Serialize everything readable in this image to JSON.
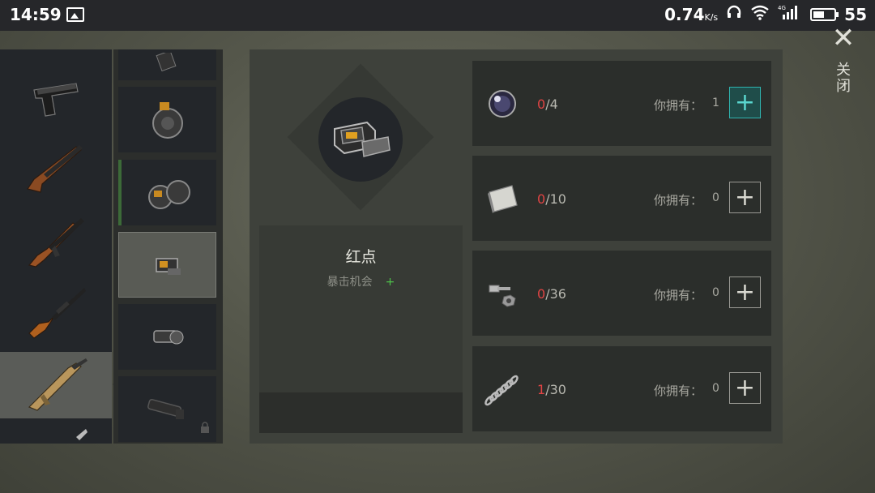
{
  "status_bar": {
    "time": "14:59",
    "speed": "0.74",
    "speed_unit": "K/s",
    "battery": "55",
    "battery_level": 0.55,
    "icons": [
      "image-icon",
      "headphones-icon",
      "wifi-icon",
      "signal-4g-icon",
      "battery-icon"
    ]
  },
  "weapons": [
    {
      "name": "pistol-icon"
    },
    {
      "name": "shotgun-icon"
    },
    {
      "name": "ak-rifle-icon"
    },
    {
      "name": "sniper-rifle-icon"
    },
    {
      "name": "scar-rifle-icon",
      "selected": true
    },
    {
      "name": "partial-rifle-icon"
    }
  ],
  "attachments": [
    {
      "name": "magazine-icon"
    },
    {
      "name": "drum-magazine-icon"
    },
    {
      "name": "dual-drum-magazine-icon"
    },
    {
      "name": "red-dot-sight-icon",
      "selected": true
    },
    {
      "name": "scope-2x-icon"
    },
    {
      "name": "scope-long-icon",
      "locked": true
    }
  ],
  "detail": {
    "item_icon": "red-dot-sight-icon",
    "name": "红点",
    "stat_label": "暴击机会",
    "stat_value": "+"
  },
  "materials": [
    {
      "icon": "lens-icon",
      "current": "0",
      "required": "/4",
      "own_label": "你拥有：",
      "own": "1",
      "add": "+",
      "active": true
    },
    {
      "icon": "metal-sheet-icon",
      "current": "0",
      "required": "/10",
      "own_label": "你拥有：",
      "own": "0",
      "add": "+",
      "active": false
    },
    {
      "icon": "bolt-nut-icon",
      "current": "0",
      "required": "/36",
      "own_label": "你拥有：",
      "own": "0",
      "add": "+",
      "active": false
    },
    {
      "icon": "spring-icon",
      "current": "1",
      "required": "/30",
      "own_label": "你拥有：",
      "own": "0",
      "add": "+",
      "active": false
    }
  ],
  "close": {
    "icon": "close-icon",
    "label": "关闭"
  },
  "colors": {
    "accent": "#2fb5b0",
    "deficit": "#e24444",
    "positive": "#4ec24a"
  }
}
